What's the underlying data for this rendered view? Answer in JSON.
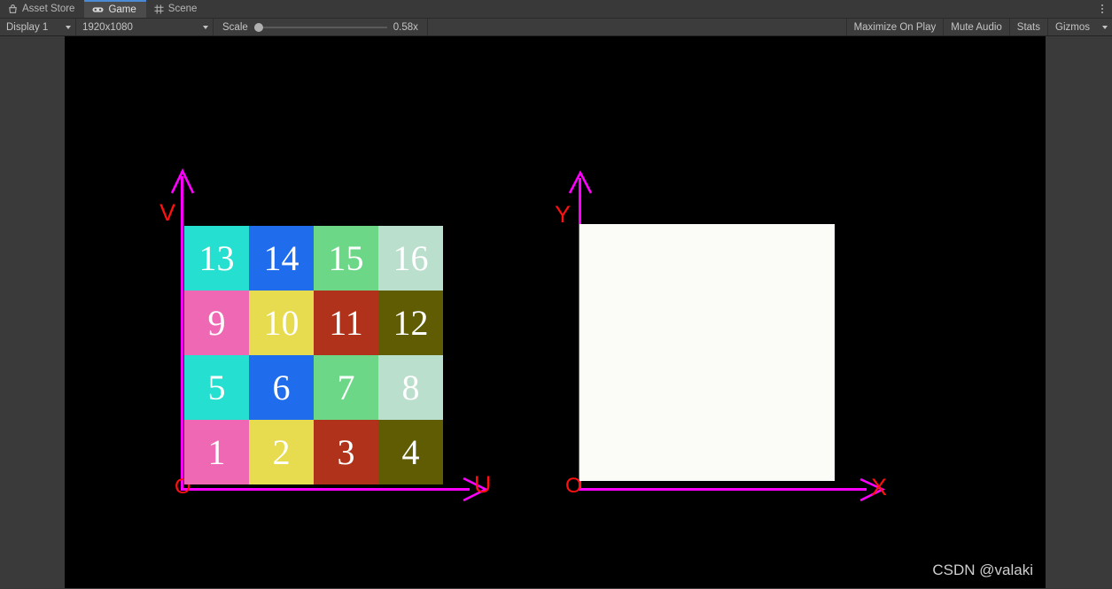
{
  "tabs": [
    {
      "label": "Asset Store",
      "icon": "store-icon",
      "active": false
    },
    {
      "label": "Game",
      "icon": "gamepad-icon",
      "active": true
    },
    {
      "label": "Scene",
      "icon": "grid-icon",
      "active": false
    }
  ],
  "toolbar": {
    "display": "Display 1",
    "resolution": "1920x1080",
    "scale_label": "Scale",
    "scale_value": "0.58x",
    "scale_percent": 2,
    "maximize_on_play": "Maximize On Play",
    "mute_audio": "Mute Audio",
    "stats": "Stats",
    "gizmos": "Gizmos"
  },
  "colors": {
    "magenta_axis": "#ff00ff",
    "red_label": "#ff1111",
    "stage_background": "#000000",
    "white_quad": "#fbfbf8",
    "tab_active_accent": "#4d8ad6"
  },
  "uv_diagram": {
    "v_axis_label": "V",
    "u_axis_label": "U",
    "origin_label": "O",
    "tiles": [
      {
        "label": "13",
        "color": "#25e0d0"
      },
      {
        "label": "14",
        "color": "#1f6ced"
      },
      {
        "label": "15",
        "color": "#6cd887"
      },
      {
        "label": "16",
        "color": "#bbdfcd"
      },
      {
        "label": "9",
        "color": "#ee68b4"
      },
      {
        "label": "10",
        "color": "#e7dc4f"
      },
      {
        "label": "11",
        "color": "#b0321a"
      },
      {
        "label": "12",
        "color": "#5f5c04"
      },
      {
        "label": "5",
        "color": "#25e0d0"
      },
      {
        "label": "6",
        "color": "#1f6ced"
      },
      {
        "label": "7",
        "color": "#6cd887"
      },
      {
        "label": "8",
        "color": "#bbdfcd"
      },
      {
        "label": "1",
        "color": "#ee68b4"
      },
      {
        "label": "2",
        "color": "#e7dc4f"
      },
      {
        "label": "3",
        "color": "#b0321a"
      },
      {
        "label": "4",
        "color": "#5f5c04"
      }
    ]
  },
  "xy_diagram": {
    "y_axis_label": "Y",
    "x_axis_label": "X",
    "origin_label": "O"
  },
  "watermark": "CSDN @valaki"
}
